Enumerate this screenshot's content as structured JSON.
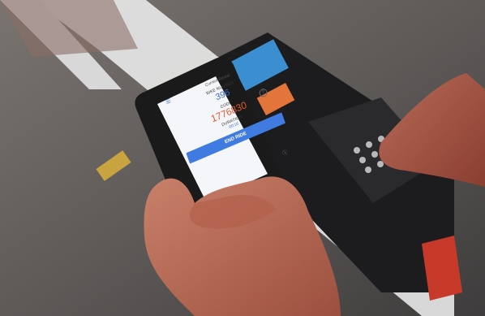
{
  "app": {
    "title": "Current Rental",
    "menu_icon": "menu-icon",
    "bike_label": "BIKE NUMBER",
    "bike_number": "396",
    "code_label": "CODE",
    "code_value": "1776830",
    "duration_label": "DURATION",
    "duration_value": "00:16",
    "help_icon": "help-icon",
    "end_ride_label": "END RIDE",
    "footer_icon": "info-icon"
  },
  "colors": {
    "accent_blue": "#3f7be0",
    "code_orange": "#e5562f",
    "phone_body": "#1a1a1a"
  }
}
